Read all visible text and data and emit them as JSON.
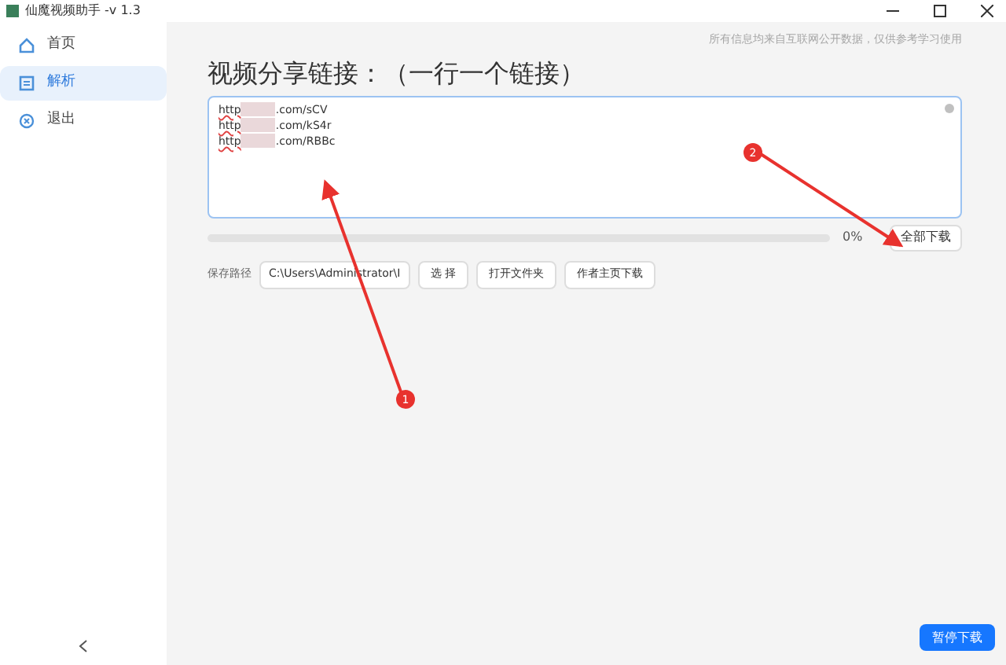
{
  "window": {
    "title": "仙魔视频助手 -v 1.3"
  },
  "sidebar": {
    "items": [
      {
        "label": "首页",
        "selected": false,
        "kind": "home"
      },
      {
        "label": "解析",
        "selected": true,
        "kind": "parse"
      },
      {
        "label": "退出",
        "selected": false,
        "kind": "exit"
      }
    ]
  },
  "notice": "所有信息均来自互联网公开数据，仅供参考学习使用",
  "heading": "视频分享链接：（一行一个链接）",
  "links": [
    {
      "prefix": "http",
      "suffix": ".com/sCV"
    },
    {
      "prefix": "http",
      "suffix": ".com/kS4r"
    },
    {
      "prefix": "http",
      "suffix": ".com/RBBc"
    }
  ],
  "progress": {
    "level": 0,
    "reading": "0%"
  },
  "download_all_button": "全部下载",
  "save_path": {
    "label": "保存路径",
    "value": "C:\\Users\\Administrator\\I"
  },
  "path_buttons": [
    "选 择",
    "打开文件夹",
    "作者主页下载"
  ],
  "pause_button": "暂停下载",
  "annotations": [
    {
      "label": "1"
    },
    {
      "label": "2"
    }
  ]
}
